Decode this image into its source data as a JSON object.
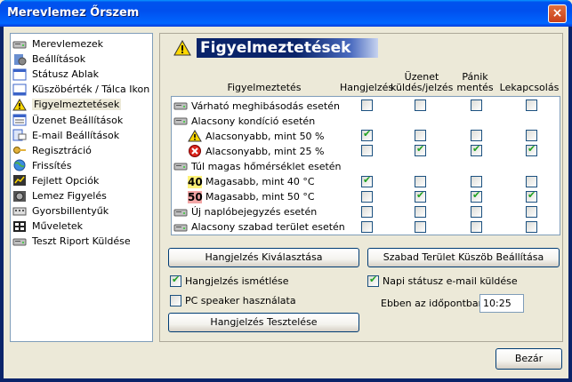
{
  "window": {
    "title": "Merevlemez Őrszem",
    "close_label": "×"
  },
  "sidebar": {
    "items": [
      {
        "label": "Merevlemezek",
        "icon": "hdd-icon",
        "selected": false
      },
      {
        "label": "Beállítások",
        "icon": "settings-icon",
        "selected": false
      },
      {
        "label": "Státusz Ablak",
        "icon": "window-icon",
        "selected": false
      },
      {
        "label": "Küszöbérték / Tálca Ikon",
        "icon": "tray-icon",
        "selected": false
      },
      {
        "label": "Figyelmeztetések",
        "icon": "warning-icon",
        "selected": true
      },
      {
        "label": "Üzenet Beállítások",
        "icon": "message-icon",
        "selected": false
      },
      {
        "label": "E-mail Beállítások",
        "icon": "email-icon",
        "selected": false
      },
      {
        "label": "Regisztráció",
        "icon": "key-icon",
        "selected": false
      },
      {
        "label": "Frissítés",
        "icon": "globe-icon",
        "selected": false
      },
      {
        "label": "Fejlett Opciók",
        "icon": "advanced-icon",
        "selected": false
      },
      {
        "label": "Lemez Figyelés",
        "icon": "disk-monitor-icon",
        "selected": false
      },
      {
        "label": "Gyorsbillentyűk",
        "icon": "keyboard-icon",
        "selected": false
      },
      {
        "label": "Műveletek",
        "icon": "actions-icon",
        "selected": false
      },
      {
        "label": "Teszt Riport Küldése",
        "icon": "hdd-icon",
        "selected": false
      }
    ]
  },
  "panel": {
    "title": "Figyelmeztetések",
    "columns": {
      "warnings": "Figyelmeztetés",
      "sound": "Hangjelzés",
      "message_l1": "Üzenet",
      "message_l2": "küldés/jelzés",
      "panic_l1": "Pánik",
      "panic_l2": "mentés",
      "shutdown": "Lekapcsolás"
    },
    "rows": [
      {
        "label": "Várható meghibásodás esetén",
        "icon": "hdd-icon",
        "indent": 0,
        "checks": [
          false,
          false,
          false,
          false
        ]
      },
      {
        "label": "Alacsony kondíció esetén",
        "icon": "hdd-icon",
        "indent": 0,
        "checks": null
      },
      {
        "label": "Alacsonyabb, mint 50 %",
        "icon": "warning-icon",
        "indent": 1,
        "checks": [
          true,
          false,
          false,
          false
        ]
      },
      {
        "label": "Alacsonyabb, mint 25 %",
        "icon": "error-icon",
        "indent": 1,
        "checks": [
          false,
          true,
          true,
          true
        ]
      },
      {
        "label": "Túl magas hőmérséklet esetén",
        "icon": "hdd-icon",
        "indent": 0,
        "checks": null
      },
      {
        "label": "Magasabb, mint 40 °C",
        "icon": "temp40-icon",
        "badge": "40",
        "indent": 1,
        "checks": [
          true,
          false,
          false,
          false
        ]
      },
      {
        "label": "Magasabb, mint 50 °C",
        "icon": "temp50-icon",
        "badge": "50",
        "indent": 1,
        "checks": [
          false,
          true,
          true,
          true
        ]
      },
      {
        "label": "Új naplóbejegyzés esetén",
        "icon": "hdd-icon",
        "indent": 0,
        "checks": [
          false,
          false,
          false,
          false
        ]
      },
      {
        "label": "Alacsony szabad terület esetén",
        "icon": "hdd-icon",
        "indent": 0,
        "checks": [
          false,
          false,
          false,
          false
        ]
      }
    ],
    "buttons": {
      "sound_select": "Hangjelzés Kiválasztása",
      "free_space": "Szabad Terület Küszöb Beállítása",
      "sound_test": "Hangjelzés Tesztelése"
    },
    "options": {
      "repeat_sound": {
        "label": "Hangjelzés ismétlése",
        "checked": true
      },
      "pc_speaker": {
        "label": "PC speaker használata",
        "checked": false
      },
      "daily_email": {
        "label": "Napi státusz e-mail küldése",
        "checked": true
      }
    },
    "time": {
      "label": "Ebben az időpontban:",
      "value": "10:25"
    }
  },
  "footer": {
    "close_label": "Bezár"
  }
}
